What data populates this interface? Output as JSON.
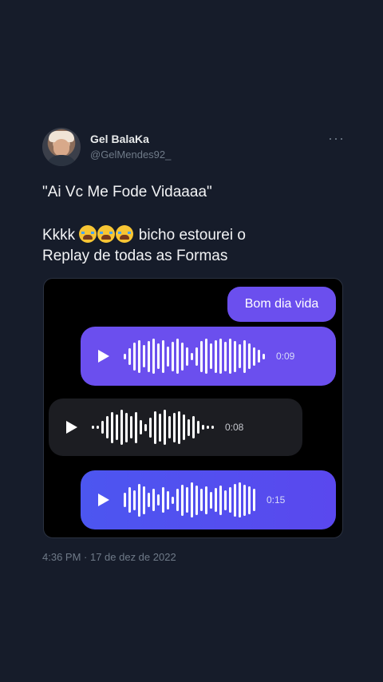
{
  "tweet": {
    "author_name": "Gel BalaKa",
    "author_handle": "@GelMendes92_",
    "more_label": "···",
    "line1": "\"Ai Vc Me Fode Vidaaaa\"",
    "line2_prefix": "Kkkk",
    "line2_suffix": "bicho estourei o",
    "line3": "Replay de todas as Formas",
    "timestamp": "4:36 PM · 17 de dez de 2022"
  },
  "media": {
    "text_message": "Bom dia vida",
    "voice_messages": [
      {
        "sender": "sent",
        "duration": "0:09",
        "wave_levels": [
          0.15,
          0.45,
          0.75,
          0.9,
          0.6,
          0.85,
          0.95,
          0.7,
          0.9,
          0.55,
          0.8,
          0.95,
          0.75,
          0.5,
          0.2,
          0.5,
          0.85,
          0.95,
          0.7,
          0.9,
          0.95,
          0.8,
          0.95,
          0.85,
          0.65,
          0.9,
          0.7,
          0.5,
          0.35,
          0.15
        ]
      },
      {
        "sender": "received",
        "duration": "0:08",
        "wave_levels": [
          0.08,
          0.08,
          0.35,
          0.6,
          0.85,
          0.7,
          0.95,
          0.8,
          0.6,
          0.85,
          0.4,
          0.2,
          0.55,
          0.9,
          0.75,
          0.95,
          0.6,
          0.8,
          0.9,
          0.7,
          0.45,
          0.6,
          0.35,
          0.12,
          0.08,
          0.08
        ]
      },
      {
        "sender": "sent",
        "duration": "0:15",
        "wave_levels": [
          0.4,
          0.7,
          0.55,
          0.9,
          0.75,
          0.4,
          0.6,
          0.3,
          0.7,
          0.5,
          0.2,
          0.6,
          0.85,
          0.7,
          0.95,
          0.8,
          0.6,
          0.75,
          0.45,
          0.65,
          0.8,
          0.55,
          0.7,
          0.9,
          0.95,
          0.85,
          0.75,
          0.6
        ]
      }
    ]
  },
  "colors": {
    "background": "#161c2a",
    "sent_bubble": "#6b4fee",
    "received_bubble": "#1c1d22",
    "muted_text": "#6f7a88"
  }
}
